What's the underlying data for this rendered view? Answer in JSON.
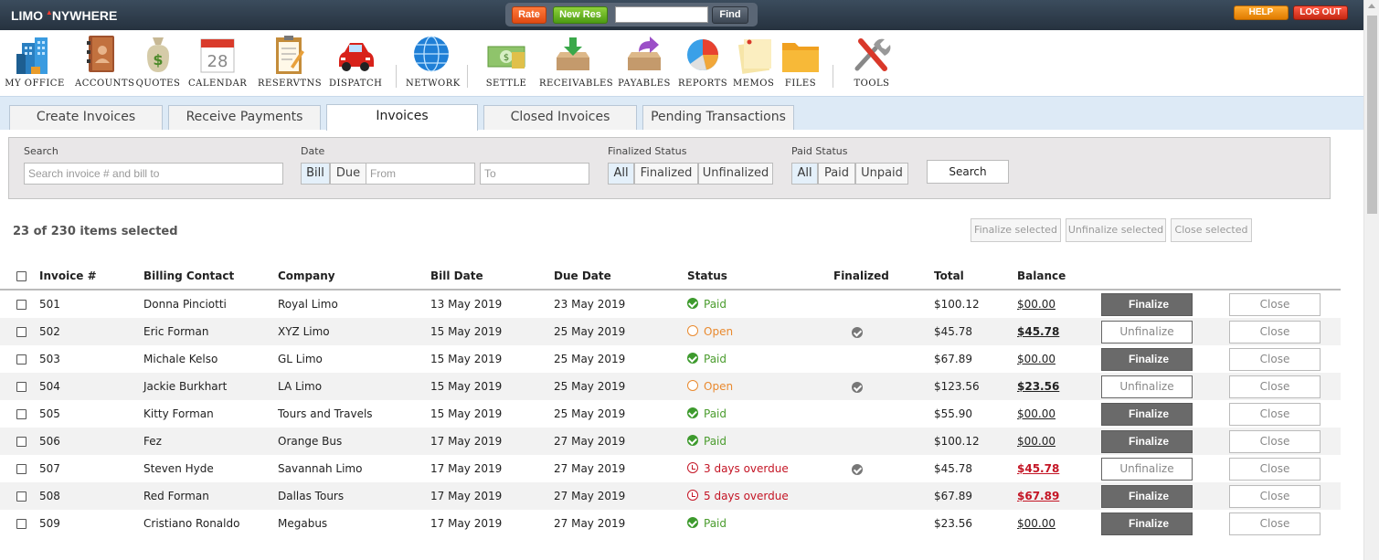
{
  "app": {
    "logo_left": "LIMO",
    "logo_right": "NYWHERE"
  },
  "topbar": {
    "rate": "Rate",
    "new_res": "New Res",
    "find_value": "",
    "find": "Find",
    "help": "HELP",
    "logout": "LOG OUT"
  },
  "toolbar": [
    {
      "label": "MY OFFICE",
      "icon": "office-building-icon"
    },
    {
      "label": "ACCOUNTS",
      "icon": "address-book-icon"
    },
    {
      "label": "QUOTES",
      "icon": "money-bag-icon"
    },
    {
      "label": "CALENDAR",
      "icon": "calendar-icon",
      "day": "28"
    },
    {
      "label": "RESERVTNS",
      "icon": "clipboard-icon"
    },
    {
      "label": "DISPATCH",
      "icon": "car-icon"
    },
    {
      "label": "NETWORK",
      "icon": "globe-icon"
    },
    {
      "label": "SETTLE",
      "icon": "cash-icon"
    },
    {
      "label": "RECEIVABLES",
      "icon": "inbox-icon"
    },
    {
      "label": "PAYABLES",
      "icon": "outbox-icon"
    },
    {
      "label": "REPORTS",
      "icon": "pie-chart-icon"
    },
    {
      "label": "MEMOS",
      "icon": "notes-icon"
    },
    {
      "label": "FILES",
      "icon": "folder-icon"
    },
    {
      "label": "TOOLS",
      "icon": "tools-icon"
    }
  ],
  "tabs": [
    "Create Invoices",
    "Receive Payments",
    "Invoices",
    "Closed Invoices",
    "Pending Transactions"
  ],
  "filters": {
    "search_label": "Search",
    "search_placeholder": "Search invoice # and bill to",
    "date_label": "Date",
    "date_bill": "Bill",
    "date_due": "Due",
    "from_placeholder": "From",
    "to_placeholder": "To",
    "finalized_label": "Finalized Status",
    "fin_all": "All",
    "fin_finalized": "Finalized",
    "fin_unfinalized": "Unfinalized",
    "paid_label": "Paid Status",
    "paid_all": "All",
    "paid_paid": "Paid",
    "paid_unpaid": "Unpaid",
    "search_button": "Search"
  },
  "selection": {
    "count_text": "23 of 230 items selected",
    "finalize_selected": "Finalize selected",
    "unfinalize_selected": "Unfinalize selected",
    "close_selected": "Close selected"
  },
  "table": {
    "headers": [
      "Invoice #",
      "Billing Contact",
      "Company",
      "Bill Date",
      "Due Date",
      "Status",
      "Finalized",
      "Total",
      "Balance"
    ],
    "rows": [
      {
        "invoice": "501",
        "contact": "Donna Pinciotti",
        "company": "Royal Limo",
        "bill": "13 May 2019",
        "due": "23 May 2019",
        "status": "Paid",
        "status_kind": "paid",
        "finalized": false,
        "total": "$100.12",
        "balance": "$00.00",
        "balance_kind": "zero",
        "action": "Finalize",
        "close": "Close"
      },
      {
        "invoice": "502",
        "contact": "Eric Forman",
        "company": "XYZ Limo",
        "bill": "15 May 2019",
        "due": "25 May 2019",
        "status": "Open",
        "status_kind": "open",
        "finalized": true,
        "total": "$45.78",
        "balance": "$45.78",
        "balance_kind": "due",
        "action": "Unfinalize",
        "close": "Close"
      },
      {
        "invoice": "503",
        "contact": "Michale Kelso",
        "company": "GL Limo",
        "bill": "15 May 2019",
        "due": "25 May 2019",
        "status": "Paid",
        "status_kind": "paid",
        "finalized": false,
        "total": "$67.89",
        "balance": "$00.00",
        "balance_kind": "zero",
        "action": "Finalize",
        "close": "Close"
      },
      {
        "invoice": "504",
        "contact": "Jackie Burkhart",
        "company": "LA Limo",
        "bill": "15 May 2019",
        "due": "25 May 2019",
        "status": "Open",
        "status_kind": "open",
        "finalized": true,
        "total": "$123.56",
        "balance": "$23.56",
        "balance_kind": "due",
        "action": "Unfinalize",
        "close": "Close"
      },
      {
        "invoice": "505",
        "contact": "Kitty Forman",
        "company": "Tours and Travels",
        "bill": "15 May 2019",
        "due": "25 May 2019",
        "status": "Paid",
        "status_kind": "paid",
        "finalized": false,
        "total": "$55.90",
        "balance": "$00.00",
        "balance_kind": "zero",
        "action": "Finalize",
        "close": "Close"
      },
      {
        "invoice": "506",
        "contact": "Fez",
        "company": "Orange Bus",
        "bill": "17 May 2019",
        "due": "27 May 2019",
        "status": "Paid",
        "status_kind": "paid",
        "finalized": false,
        "total": "$100.12",
        "balance": "$00.00",
        "balance_kind": "zero",
        "action": "Finalize",
        "close": "Close"
      },
      {
        "invoice": "507",
        "contact": "Steven Hyde",
        "company": "Savannah Limo",
        "bill": "17 May 2019",
        "due": "27 May 2019",
        "status": "3 days overdue",
        "status_kind": "overdue",
        "finalized": true,
        "total": "$45.78",
        "balance": "$45.78",
        "balance_kind": "overdue",
        "action": "Unfinalize",
        "close": "Close"
      },
      {
        "invoice": "508",
        "contact": "Red Forman",
        "company": "Dallas Tours",
        "bill": "17 May 2019",
        "due": "27 May 2019",
        "status": "5 days overdue",
        "status_kind": "overdue",
        "finalized": false,
        "total": "$67.89",
        "balance": "$67.89",
        "balance_kind": "overdue",
        "action": "Finalize",
        "close": "Close"
      },
      {
        "invoice": "509",
        "contact": "Cristiano Ronaldo",
        "company": "Megabus",
        "bill": "17 May 2019",
        "due": "27 May 2019",
        "status": "Paid",
        "status_kind": "paid",
        "finalized": false,
        "total": "$23.56",
        "balance": "$00.00",
        "balance_kind": "zero",
        "action": "Finalize",
        "close": "Close"
      }
    ]
  },
  "colors": {
    "paid": "#4a9c2d",
    "open": "#e98a2f",
    "overdue": "#c41525",
    "finalize_button": "#6a6a6a"
  }
}
